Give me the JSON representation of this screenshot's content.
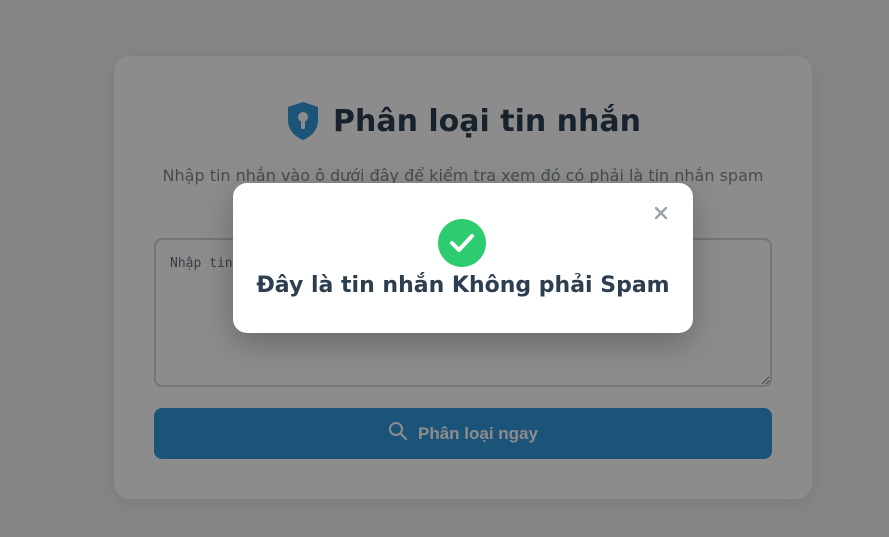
{
  "header": {
    "title": "Phân loại tin nhắn",
    "subtitle": "Nhập tin nhắn vào ô dưới đây để kiểm tra xem đó có phải là tin nhắn spam"
  },
  "input": {
    "placeholder": "Nhập tin..."
  },
  "button": {
    "label": "Phân loại ngay"
  },
  "modal": {
    "message": "Đây là tin nhắn Không phải Spam",
    "close_label": "×"
  },
  "icons": {
    "title_icon": "shield-lock-icon",
    "button_icon": "search-icon",
    "modal_icon": "check-circle-icon",
    "close_icon": "close-icon"
  },
  "colors": {
    "primary": "#3498db",
    "title_text": "#2c3e50",
    "success": "#2ecc71"
  }
}
